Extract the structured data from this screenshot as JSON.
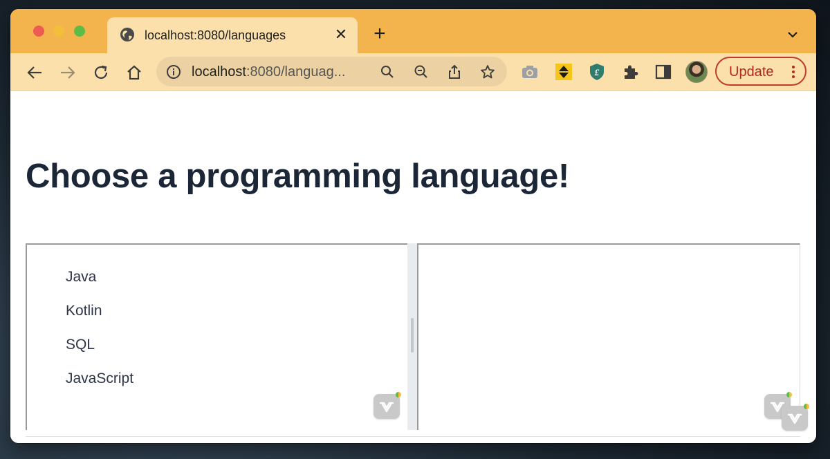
{
  "browser": {
    "tab": {
      "title": "localhost:8080/languages"
    },
    "address": {
      "host": "localhost",
      "path": ":8080/languag..."
    },
    "update_label": "Update"
  },
  "page": {
    "title": "Choose a programming language!",
    "languages": [
      "Java",
      "Kotlin",
      "SQL",
      "JavaScript"
    ]
  },
  "colors": {
    "tab_strip": "#f4b44d",
    "toolbar": "#fbe0ac",
    "heading": "#1b2636",
    "update_accent": "#b3261e"
  }
}
